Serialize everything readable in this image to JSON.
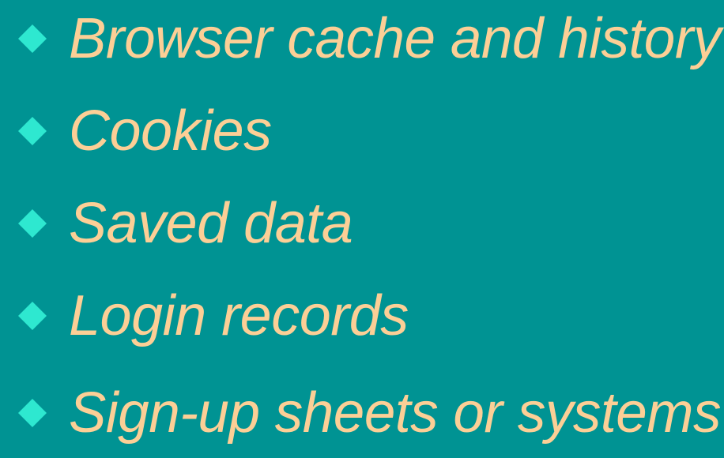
{
  "colors": {
    "background": "#009393",
    "text": "#fccf96",
    "bullet": "#2ee8d0"
  },
  "bullet_icon": "diamond-icon",
  "items": [
    {
      "label": "Browser cache and history"
    },
    {
      "label": "Cookies"
    },
    {
      "label": "Saved data"
    },
    {
      "label": "Login records"
    },
    {
      "label": "Sign-up sheets or systems"
    }
  ]
}
